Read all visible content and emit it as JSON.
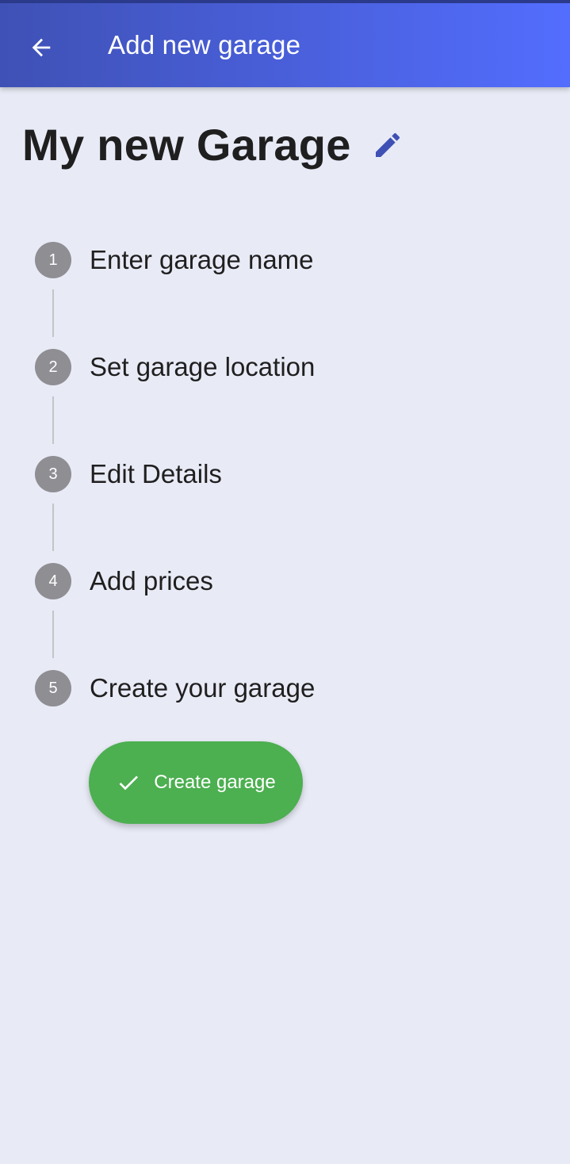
{
  "appbar": {
    "title": "Add new garage",
    "back_icon": "arrow-left-icon",
    "gradient_start": "#3f51b5",
    "gradient_end": "#536dfe"
  },
  "garage": {
    "name": "My new Garage",
    "edit_icon": "pencil-icon",
    "edit_icon_color": "#3f51b5"
  },
  "steps": [
    {
      "number": "1",
      "label": "Enter garage name"
    },
    {
      "number": "2",
      "label": "Set garage location"
    },
    {
      "number": "3",
      "label": "Edit Details"
    },
    {
      "number": "4",
      "label": "Add prices"
    },
    {
      "number": "5",
      "label": "Create your garage"
    }
  ],
  "create_button": {
    "label": "Create garage",
    "icon": "check-icon",
    "color": "#4caf50"
  },
  "colors": {
    "background": "#e8eaf6",
    "step_circle": "#8e8e93",
    "text": "#1f1f1f"
  }
}
